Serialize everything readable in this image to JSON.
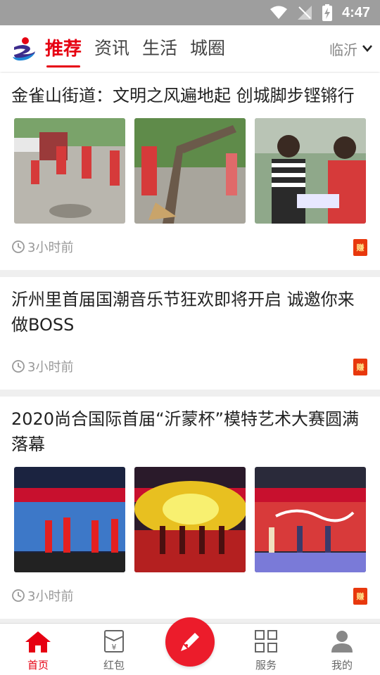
{
  "status_bar": {
    "time": "4:47"
  },
  "header": {
    "tabs": [
      {
        "label": "推荐",
        "active": true
      },
      {
        "label": "资讯",
        "active": false
      },
      {
        "label": "生活",
        "active": false
      },
      {
        "label": "城圈",
        "active": false
      }
    ],
    "city": "临沂"
  },
  "colors": {
    "accent": "#e60012",
    "redpack": "#e8380d"
  },
  "feed": [
    {
      "title": "金雀山街道：文明之风遍地起 创城脚步铿锵行",
      "time": "3小时前",
      "badge": "赚",
      "images": [
        "volunteers-sweeping-street",
        "volunteers-sweeping-under-tree",
        "volunteer-handing-leaflets"
      ]
    },
    {
      "title": "沂州里首届国潮音乐节狂欢即将开启 诚邀你来做BOSS",
      "time": "3小时前",
      "badge": "赚"
    },
    {
      "title": "2020尚合国际首届“沂蒙杯”模特艺术大赛圆满落幕",
      "time": "3小时前",
      "badge": "赚",
      "images": [
        "models-on-stage-blue-lights",
        "models-on-stage-yellow-lights",
        "contest-award-stage"
      ]
    }
  ],
  "bottom_nav": [
    {
      "label": "首页",
      "icon": "home-icon",
      "active": true
    },
    {
      "label": "红包",
      "icon": "red-envelope-icon",
      "active": false
    },
    {
      "label": "服务",
      "icon": "grid-icon",
      "active": false
    },
    {
      "label": "我的",
      "icon": "profile-icon",
      "active": false
    }
  ]
}
